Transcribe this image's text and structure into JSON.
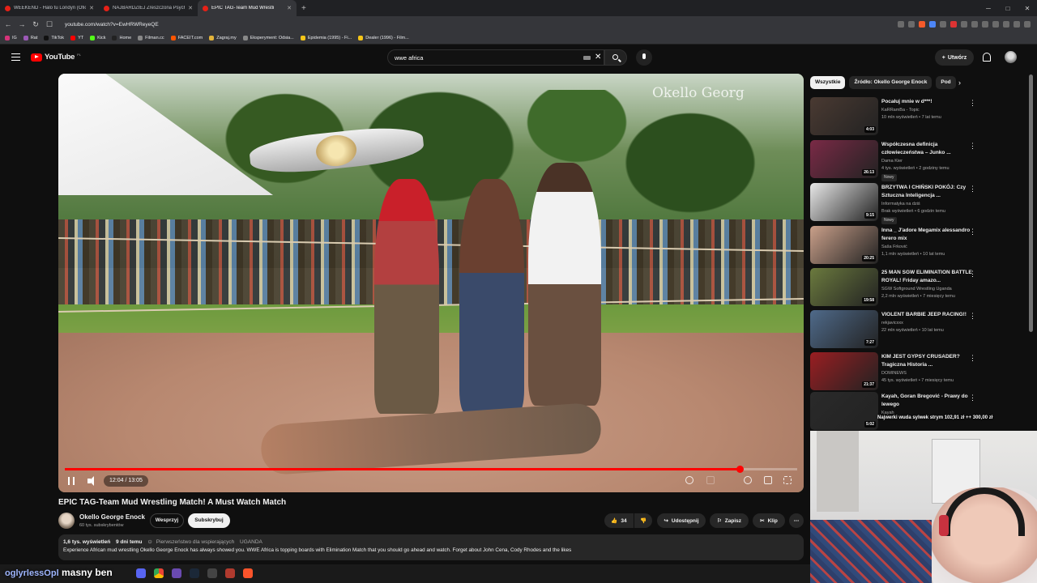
{
  "browser": {
    "tabs": [
      {
        "title": "WEEKEND - Halo tu Londyn (Oficjaln"
      },
      {
        "title": "NAJBARDZIEJ Zreszczona Psychicznie"
      },
      {
        "title": "EPIC TAG-Team Mud Wrestli",
        "active": true
      }
    ],
    "new_tab": "+",
    "url": "youtube.com/watch?v=EwHRWReyeQE",
    "bookmarks": [
      "IG",
      "Rat",
      "TikTok",
      "YT",
      "Kick",
      "Home",
      "Filman.cc",
      "FACEIT.com",
      "Zagraj.my",
      "Eksperyment: Odsia...",
      "Epidemia (1995) - Fi...",
      "Dealer (1996) - Film..."
    ]
  },
  "youtube": {
    "logo": "YouTube",
    "country": "PL",
    "search_value": "wwe africa",
    "create_label": "Utwórz",
    "icons": {
      "menu": "hamburger-menu-icon",
      "search": "search-icon",
      "mic": "microphone-icon",
      "bell": "bell-icon",
      "clear": "clear-icon"
    }
  },
  "video": {
    "watermark": "Okello Georg",
    "time_label": "12:04 / 13:05",
    "progress": 0.921,
    "title": "EPIC TAG-Team Mud Wrestling Match! A Must Watch Match",
    "channel": "Okello George Enock",
    "subs": "60 tys. subskrybentów",
    "join": "Wesprzyj",
    "subscribe": "Subskrybuj",
    "likes": "34",
    "share": "Udostępnij",
    "save": "Zapisz",
    "clip": "Klip",
    "views": "1,6 tys. wyświetleń",
    "age": "9 dni temu",
    "priority": "Pierwszeństwo dla wspierających",
    "country": "UGANDA",
    "description": "Experience African mud wrestling Okello George Enock has always showed you. WWE Africa is topping boards with Elimination Match that you should go ahead and watch. Forget about John Cena, Cody Rhodes and the likes"
  },
  "sidebar": {
    "chips": [
      "Wszystkie",
      "Źródło: Okello George Enock",
      "Pod"
    ],
    "items": [
      {
        "title": "Pocałuj mnie w d***!",
        "channel": "KaRRamBa - Topic",
        "stats": "10 mln wyświetleń • 7 lat temu",
        "duration": "4:03",
        "badge": "",
        "color": "#4a3a32"
      },
      {
        "title": "Współczesna definicja człowieczeństwa – Junko ...",
        "channel": "Dama Kier",
        "stats": "4 tys. wyświetleń • 2 godziny temu",
        "duration": "26:13",
        "badge": "Nowy",
        "color": "#7a2a46"
      },
      {
        "title": "BRZYTWA I CHIŃSKI POKÓJ: Czy Sztuczna Inteligencja ...",
        "channel": "Informatyka na dziś",
        "stats": "Brak wyświetleń • 6 godzin temu",
        "duration": "9:15",
        "badge": "Nowy",
        "color": "#e8e8e8"
      },
      {
        "title": "Inna _ J'adore Megamix alessandro ferero mix",
        "channel": "Saša Frković",
        "stats": "1,1 mln wyświetleń • 10 lat temu",
        "duration": "20:25",
        "badge": "",
        "color": "#caa08a"
      },
      {
        "title": "25 MAN SGW ELIMINATION BATTLE ROYAL! Friday amazo...",
        "channel": "SGW Softground Wrestling Uganda",
        "stats": "2,2 mln wyświetleń • 7 miesięcy temu",
        "duration": "19:58",
        "badge": "",
        "color": "#6b7a3e"
      },
      {
        "title": "VIOLENT BARBIE JEEP RACING!!",
        "channel": "rekjavicxxx",
        "stats": "22 mln wyświetleń • 10 lat temu",
        "duration": "7:27",
        "badge": "",
        "color": "#4f6a8a"
      },
      {
        "title": "KIM JEST GYPSY CRUSADER? Tragiczna Historia ...",
        "channel": "DOMINEWS",
        "stats": "45 tys. wyświetleń • 7 miesięcy temu",
        "duration": "21:37",
        "badge": "",
        "color": "#9a1e22"
      },
      {
        "title": "Kayah, Goran Bregović - Prawy do lewego",
        "channel": "Kayah",
        "stats": "",
        "duration": "5:02",
        "badge": "",
        "color": "#2a2a2a"
      }
    ]
  },
  "overlay": {
    "ticker": "Najwerki wuda sylwek strym 102,91 zł ++ 300,00 zł",
    "taskbar_user": "oglyrlessOpl",
    "taskbar_text": "masny ben"
  }
}
